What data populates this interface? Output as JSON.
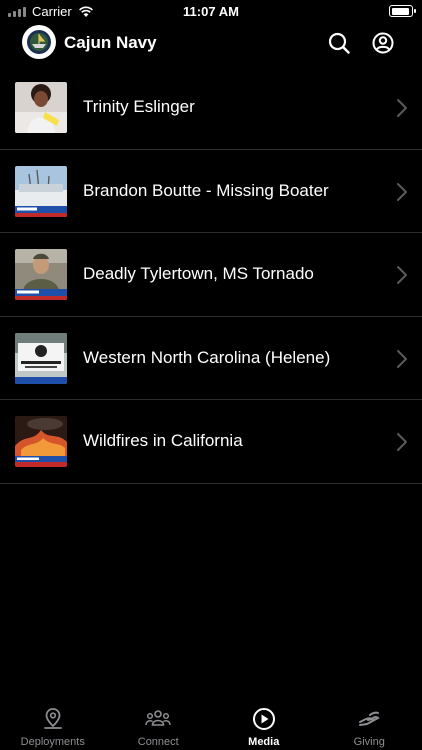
{
  "status_bar": {
    "carrier": "Carrier",
    "time": "11:07 AM",
    "battery_level": 0.95
  },
  "header": {
    "title": "Cajun Navy",
    "logo_icon": "cajun-navy-logo",
    "search_icon": "search-icon",
    "profile_icon": "user-circle-icon"
  },
  "media": [
    {
      "title": "Trinity Eslinger"
    },
    {
      "title": "Brandon Boutte - Missing Boater"
    },
    {
      "title": "Deadly Tylertown, MS Tornado"
    },
    {
      "title": "Western North Carolina (Helene)"
    },
    {
      "title": "Wildfires in California"
    }
  ],
  "tabs": [
    {
      "label": "Deployments",
      "icon": "map-pin-icon",
      "active": false
    },
    {
      "label": "Connect",
      "icon": "group-icon",
      "active": false
    },
    {
      "label": "Media",
      "icon": "play-circle-icon",
      "active": true
    },
    {
      "label": "Giving",
      "icon": "giving-hand-icon",
      "active": false
    }
  ],
  "colors": {
    "background": "#000000",
    "text": "#ffffff",
    "inactive": "#8e8e93",
    "separator": "#2c2c2e"
  }
}
